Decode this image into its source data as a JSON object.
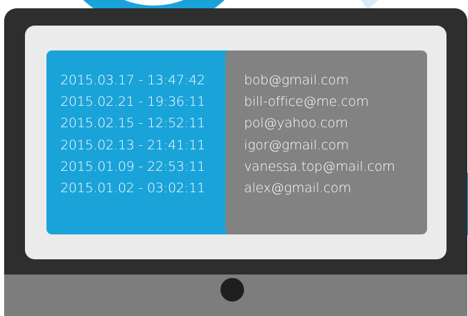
{
  "colors": {
    "accent": "#1aa3d9",
    "monitor_frame": "#2e2e2e",
    "monitor_chin": "#7d7d7d",
    "screen": "#ebebeb",
    "email_panel": "#828282",
    "text": "#ffffff"
  },
  "log": {
    "rows": [
      {
        "timestamp": "2015.03.17 - 13:47:42",
        "email": "bob@gmail.com"
      },
      {
        "timestamp": "2015.02.21 - 19:36:11",
        "email": "bill-office@me.com"
      },
      {
        "timestamp": "2015.02.15 - 12:52:11",
        "email": "pol@yahoo.com"
      },
      {
        "timestamp": "2015.02.13 - 21:41:11",
        "email": "igor@gmail.com"
      },
      {
        "timestamp": "2015.01.09 - 22:53:11",
        "email": "vanessa.top@mail.com"
      },
      {
        "timestamp": "2015.01.02 - 03:02:11",
        "email": "alex@gmail.com"
      }
    ]
  }
}
